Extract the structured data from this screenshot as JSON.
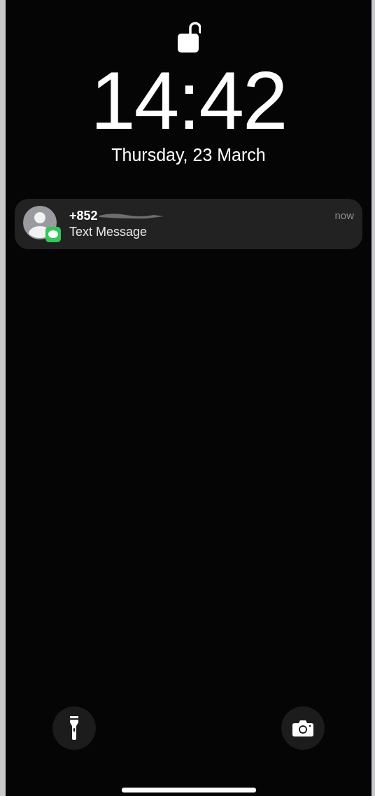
{
  "lock_screen": {
    "time": "14:42",
    "date": "Thursday, 23 March"
  },
  "notifications": [
    {
      "sender": "+852",
      "redacted": true,
      "preview": "Text Message",
      "time": "now"
    }
  ]
}
